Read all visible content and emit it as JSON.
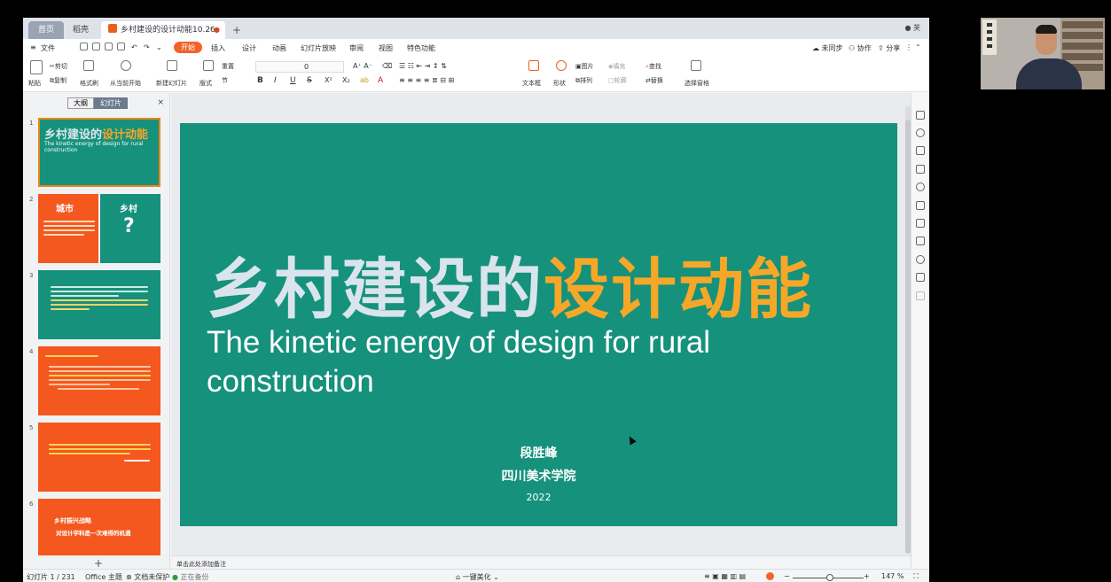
{
  "tabs": {
    "home": "首页",
    "second": "稻壳",
    "doc": "乡村建设的设计动能10.26",
    "new": "+"
  },
  "menu": {
    "file": "文件",
    "items": [
      "开始",
      "插入",
      "设计",
      "动画",
      "幻灯片放映",
      "审阅",
      "视图",
      "特色功能"
    ],
    "unsynced": "未同步",
    "collab": "协作",
    "share": "分享"
  },
  "ribbon": {
    "paste": "粘贴",
    "cut": "剪切",
    "copy": "复制",
    "format_painter": "格式刷",
    "play_from_start": "从当前开始",
    "new_slide": "新建幻灯片",
    "layout": "版式",
    "section": "节",
    "reset": "重置",
    "font_size": "0",
    "textbox": "文本框",
    "shape": "形状",
    "picture": "图片",
    "fill": "填充",
    "arrange": "排列",
    "outline": "轮廓",
    "find": "查找",
    "replace": "替换",
    "select_pane": "选择窗格"
  },
  "panel": {
    "outline_tab": "大纲",
    "slides_tab": "幻灯片",
    "close": "×",
    "add": "+"
  },
  "thumbnails": [
    {
      "num": "1",
      "title_a": "乡村建设的",
      "title_b": "设计动能",
      "sub": "The kinetic energy of design for rural construction"
    },
    {
      "num": "2",
      "left": "城市",
      "right": "乡村",
      "q": "?"
    },
    {
      "num": "3"
    },
    {
      "num": "4"
    },
    {
      "num": "5"
    },
    {
      "num": "6",
      "line1": "乡村振兴战略",
      "line2": "对设计学科是一次难得的机遇"
    }
  ],
  "slide": {
    "title_a": "乡村建设的",
    "title_b": "设计动能",
    "subtitle": "The kinetic energy of design for rural construction",
    "author": "段胜峰",
    "school": "四川美术学院",
    "year": "2022"
  },
  "notes": "单击此处添加备注",
  "status": {
    "slide_count": "幻灯片 1 / 231",
    "theme": "Office 主题",
    "unprotected": "文档未保护",
    "backup": "正在备份",
    "beautify": "一键美化",
    "zoom": "147 %"
  },
  "colors": {
    "slide_bg": "#15917c",
    "accent": "#f7a728",
    "brand": "#f0642a"
  }
}
